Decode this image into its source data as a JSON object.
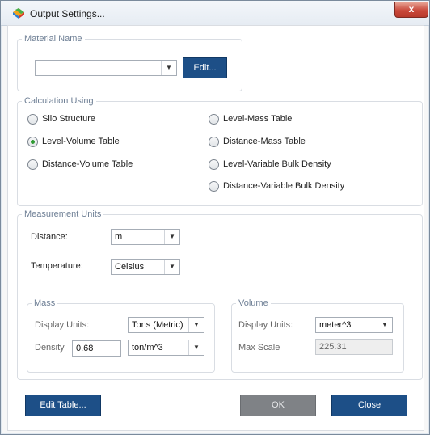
{
  "window": {
    "title": "Output Settings...",
    "close_glyph": "x"
  },
  "material_name": {
    "group_title": "Material Name",
    "selected": "",
    "edit_button": "Edit..."
  },
  "calculation": {
    "group_title": "Calculation Using",
    "options": [
      {
        "label": "Silo Structure",
        "checked": false
      },
      {
        "label": "Level-Volume Table",
        "checked": true
      },
      {
        "label": "Distance-Volume Table",
        "checked": false
      },
      {
        "label": "Level-Mass Table",
        "checked": false
      },
      {
        "label": "Distance-Mass Table",
        "checked": false
      },
      {
        "label": "Level-Variable Bulk Density",
        "checked": false
      },
      {
        "label": "Distance-Variable Bulk Density",
        "checked": false
      }
    ]
  },
  "units": {
    "group_title": "Measurement Units",
    "distance_label": "Distance:",
    "distance_value": "m",
    "temperature_label": "Temperature:",
    "temperature_value": "Celsius",
    "mass": {
      "group_title": "Mass",
      "display_units_label": "Display Units:",
      "display_units_value": "Tons (Metric)",
      "density_label": "Density",
      "density_value": "0.68",
      "density_units_value": "ton/m^3"
    },
    "volume": {
      "group_title": "Volume",
      "display_units_label": "Display Units:",
      "display_units_value": "meter^3",
      "max_scale_label": "Max Scale",
      "max_scale_value": "225.31"
    }
  },
  "footer": {
    "edit_table_button": "Edit Table...",
    "ok_button": "OK",
    "close_button": "Close"
  },
  "colors": {
    "primary_button": "#1d4f87",
    "disabled_button": "#7f8286",
    "group_title": "#6e7f95",
    "radio_checked": "#2f9a33",
    "close_button": "#c9483a"
  }
}
